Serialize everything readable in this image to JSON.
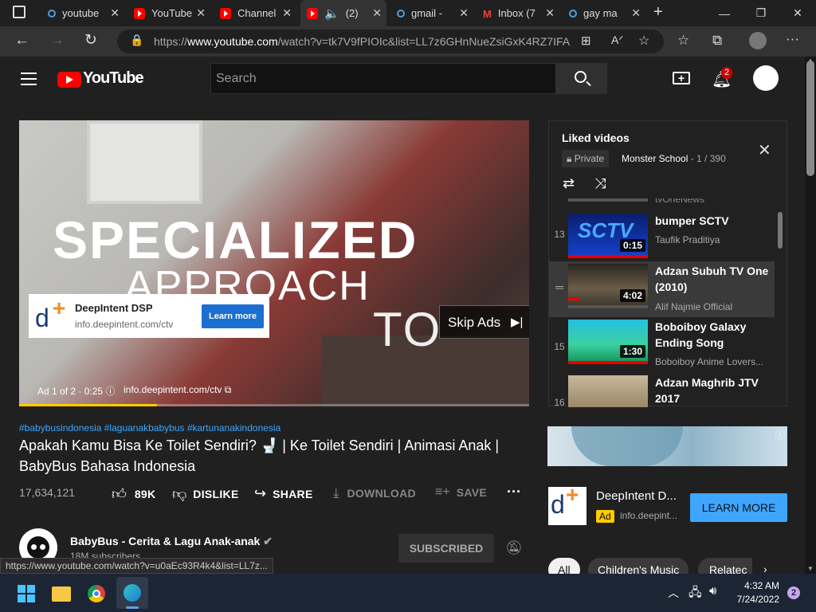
{
  "browser": {
    "tabs": [
      {
        "label": "youtube",
        "icon": "search-icon"
      },
      {
        "label": "YouTube",
        "icon": "youtube-icon"
      },
      {
        "label": "Channel",
        "icon": "youtube-icon"
      },
      {
        "label": "(2)",
        "icon": "youtube-icon"
      },
      {
        "label": "gmail -",
        "icon": "search-icon"
      },
      {
        "label": "Inbox (7",
        "icon": "gmail-icon"
      },
      {
        "label": "gay ma",
        "icon": "search-icon"
      }
    ],
    "url_prefix": "https://",
    "url_domain": "www.youtube.com",
    "url_path": "/watch?v=tk7V9fPIOIc&list=LL7z6GHnNueZsiGxK4RZ7IFA"
  },
  "yt": {
    "logo": "YouTube",
    "search_placeholder": "Search",
    "notif_count": "2"
  },
  "ad": {
    "overlay_line1": "SPECIALIZED",
    "overlay_line2": "APPROACH",
    "overlay_line3": "TO",
    "company": "DeepIntent DSP",
    "domain": "info.deepintent.com/ctv",
    "learn_more": "Learn more",
    "skip": "Skip Ads",
    "counter": "Ad 1 of 2 · 0:25",
    "counter_link": "info.deepintent.com/ctv",
    "progress": 0.27
  },
  "video": {
    "hashtags": "#babybusindonesia #laguanakbabybus #kartunanakindonesia",
    "title": "Apakah Kamu Bisa Ke Toilet Sendiri? 🚽 | Ke Toilet Sendiri | Animasi Anak | BabyBus Bahasa Indonesia",
    "views": "17,634,121",
    "likes": "89K",
    "dislike": "DISLIKE",
    "share": "SHARE",
    "download": "DOWNLOAD",
    "save": "SAVE",
    "channel": "BabyBus - Cerita & Lagu Anak-anak",
    "subscribers": "18M subscribers",
    "subscribed": "SUBSCRIBED"
  },
  "playlist": {
    "title": "Liked videos",
    "privacy": "Private",
    "current": "Monster School",
    "position": "- 1 / 390",
    "partial_channel": "tvOneNews",
    "items": [
      {
        "num": "13",
        "title": "bumper SCTV",
        "channel": "Taufik Praditiya",
        "duration": "0:15"
      },
      {
        "num": "",
        "title": "Adzan Subuh TV One (2010)",
        "channel": "Alif Najmie Official",
        "duration": "4:02"
      },
      {
        "num": "15",
        "title": "Boboiboy Galaxy Ending Song",
        "channel": "Boboiboy Anime Lovers...",
        "duration": "1:30"
      },
      {
        "num": "16",
        "title": "Adzan Maghrib JTV 2017",
        "channel": "",
        "duration": ""
      }
    ]
  },
  "side_ad": {
    "title": "DeepIntent D...",
    "badge": "Ad",
    "domain": "info.deepint...",
    "cta": "LEARN MORE"
  },
  "chips": [
    "All",
    "Children's Music",
    "Relatec"
  ],
  "status_url": "https://www.youtube.com/watch?v=u0aEc93R4k4&list=LL7z...",
  "taskbar": {
    "time": "4:32 AM",
    "date": "7/24/2022",
    "badge": "2"
  }
}
